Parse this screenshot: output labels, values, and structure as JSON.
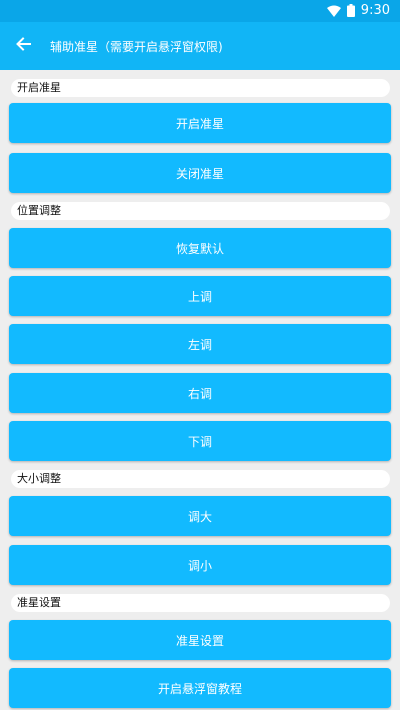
{
  "status_bar": {
    "time": "9:30",
    "wifi_icon": "wifi-icon",
    "battery_icon": "battery-icon"
  },
  "app_bar": {
    "back_icon": "arrow-back-icon",
    "title": "辅助准星（需要开启悬浮窗权限)"
  },
  "sections": {
    "crosshair": {
      "label": "开启准星",
      "buttons": [
        "开启准星",
        "关闭准星"
      ]
    },
    "position": {
      "label": "位置调整",
      "buttons": [
        "恢复默认",
        "上调",
        "左调",
        "右调",
        "下调"
      ]
    },
    "size": {
      "label": "大小调整",
      "buttons": [
        "调大",
        "调小"
      ]
    },
    "settings": {
      "label": "准星设置",
      "buttons": [
        "准星设置",
        "开启悬浮窗教程"
      ]
    }
  },
  "colors": {
    "status_bar": "#0aa6e8",
    "app_bar": "#11b5f6",
    "button": "#12baff",
    "background": "#eeeeee"
  }
}
